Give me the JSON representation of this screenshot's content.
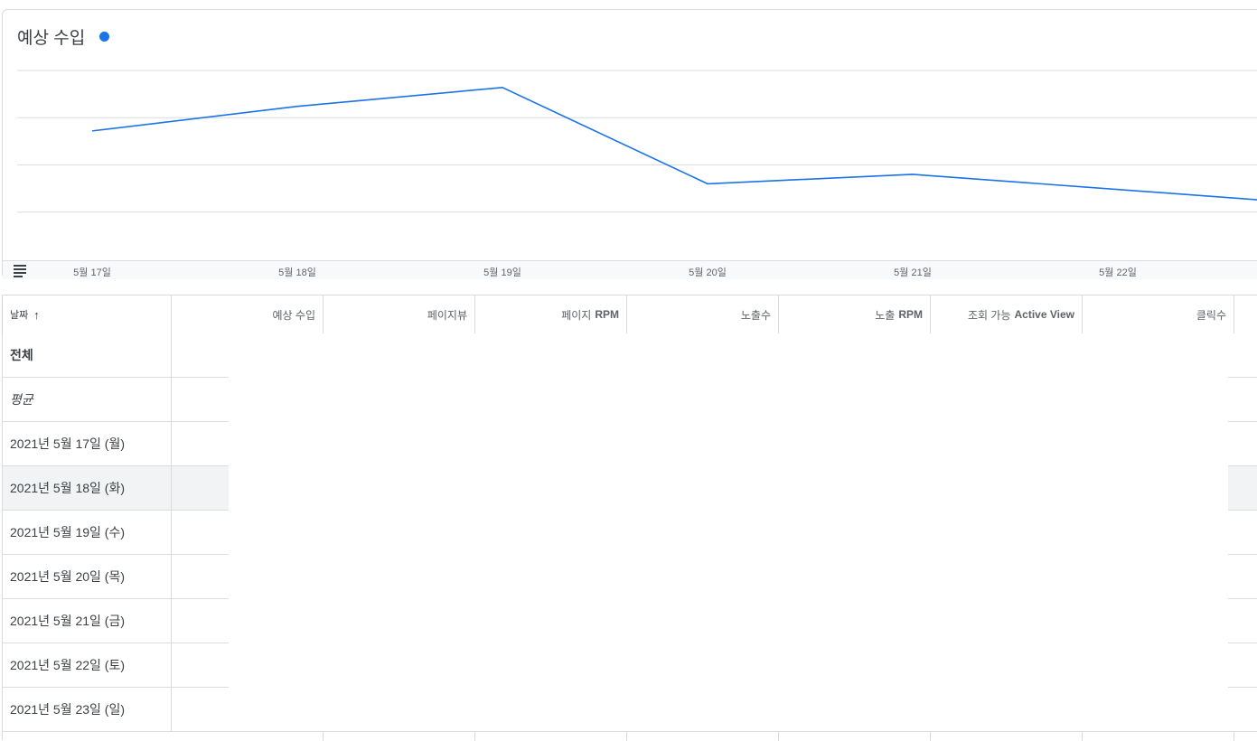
{
  "chart": {
    "title": "예상 수입",
    "series_color": "#1a73e8",
    "menu_icon": "menu-lines-icon"
  },
  "chart_data": {
    "type": "line",
    "categories": [
      "5월 17일",
      "5월 18일",
      "5월 19일",
      "5월 20일",
      "5월 21일",
      "5월 22일"
    ],
    "series": [
      {
        "values": [
          0.68,
          0.81,
          0.91,
          0.4,
          0.45,
          0.37,
          0.29
        ]
      }
    ],
    "grid": true,
    "ylim": [
      0,
      1
    ]
  },
  "table": {
    "columns": [
      {
        "label": "날짜",
        "sort_icon": "arrow-up-icon"
      },
      {
        "label": "예상 수입"
      },
      {
        "label": "페이지뷰"
      },
      {
        "label": "페이지",
        "bold": "RPM"
      },
      {
        "label": "노출수"
      },
      {
        "label": "노출",
        "bold": "RPM"
      },
      {
        "label": "조회 가능",
        "bold": "Active View"
      },
      {
        "label": "클릭수"
      }
    ],
    "rows": [
      {
        "label": "전체",
        "style": "bold"
      },
      {
        "label": "평균",
        "style": "italic"
      },
      {
        "label": "2021년 5월 17일 (월)"
      },
      {
        "label": "2021년 5월 18일 (화)",
        "hover": true
      },
      {
        "label": "2021년 5월 19일 (수)"
      },
      {
        "label": "2021년 5월 20일 (목)"
      },
      {
        "label": "2021년 5월 21일 (금)"
      },
      {
        "label": "2021년 5월 22일 (토)"
      },
      {
        "label": "2021년 5월 23일 (일)"
      }
    ]
  }
}
